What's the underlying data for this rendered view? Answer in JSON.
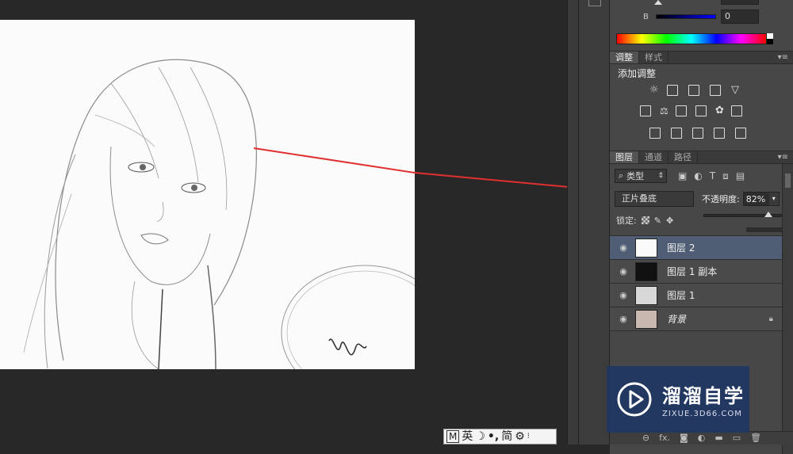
{
  "color_panel": {
    "b_label": "B",
    "value_top": "0",
    "value_b": "0"
  },
  "adjust_panel": {
    "tabs": [
      "调整",
      "样式"
    ],
    "title": "添加调整"
  },
  "layers_panel": {
    "tabs": [
      "图层",
      "通道",
      "路径"
    ],
    "filter_label": "类型",
    "blend_mode": "正片叠底",
    "opacity_label": "不透明度:",
    "opacity_value": "82%",
    "opacity_level": 0.82,
    "lock_label": "锁定:",
    "layers": [
      {
        "name": "图层 2",
        "selected": true
      },
      {
        "name": "图层 1 副本",
        "selected": false
      },
      {
        "name": "图层 1",
        "selected": false
      },
      {
        "name": "背景",
        "selected": false,
        "locked": true
      }
    ],
    "bottom_icons": [
      "link-icon",
      "fx-icon",
      "mask-icon",
      "adjustment-icon",
      "folder-icon",
      "new-layer-icon",
      "trash-icon"
    ],
    "fx_label": "fx."
  },
  "ime_bar": {
    "m": "M",
    "lang": "英",
    "moon": "☽",
    "punct": "•,",
    "mode": "简"
  },
  "watermark": {
    "title": "溜溜自学",
    "subtitle": "ZIXUE.3D66.COM"
  },
  "colors": {
    "highlight": "#e03030",
    "selected_row": "#4f5d75",
    "panel_bg": "#474747"
  }
}
